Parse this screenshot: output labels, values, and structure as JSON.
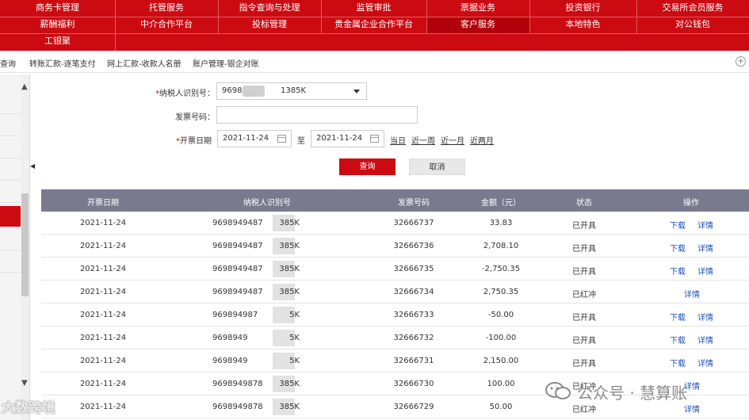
{
  "top_nav": {
    "row1": [
      "商务卡管理",
      "托管服务",
      "指令查询与处理",
      "监管审批",
      "票据业务",
      "投资银行",
      "交易所会员服务"
    ],
    "row2": [
      "薪酬福利",
      "中介合作平台",
      "投标管理",
      "贵金属企业合作平台",
      "客户服务",
      "本地特色",
      "对公钱包"
    ],
    "row3": [
      "工银聚"
    ],
    "active_item": "客户服务",
    "brand_color": "#cc0a12"
  },
  "sub_tabs": [
    "查询",
    "转账汇款-逐笔支付",
    "网上汇款-收款人名册",
    "账户管理-银企对账"
  ],
  "form": {
    "taxpayer_label": "纳税人识别号：",
    "taxpayer_value_start": "9698",
    "taxpayer_value_end": "1385K",
    "invoice_no_label": "发票号码：",
    "invoice_no_value": "",
    "date_label": "开票日期",
    "date_from": "2021-11-24",
    "date_sep": "至",
    "date_to": "2021-11-24",
    "quick_links": [
      "当日",
      "近一周",
      "近一月",
      "近两月"
    ],
    "query_button": "查询",
    "cancel_button": "取消"
  },
  "table": {
    "headers": [
      "开票日期",
      "纳税人识别号",
      "发票号码",
      "金额（元）",
      "状态",
      "操作"
    ],
    "rows": [
      {
        "date": "2021-11-24",
        "tax_id": "9698949487",
        "tax_id_end": "385K",
        "invoice_no": "32666737",
        "amount": "33.83",
        "status": "已开具",
        "ops": [
          "下载",
          "详情"
        ]
      },
      {
        "date": "2021-11-24",
        "tax_id": "9698949487",
        "tax_id_end": "385K",
        "invoice_no": "32666736",
        "amount": "2,708.10",
        "status": "已开具",
        "ops": [
          "下载",
          "详情"
        ]
      },
      {
        "date": "2021-11-24",
        "tax_id": "9698949487",
        "tax_id_end": "385K",
        "invoice_no": "32666735",
        "amount": "-2,750.35",
        "status": "已开具",
        "ops": [
          "下载",
          "详情"
        ]
      },
      {
        "date": "2021-11-24",
        "tax_id": "9698949487",
        "tax_id_end": "385K",
        "invoice_no": "32666734",
        "amount": "2,750.35",
        "status": "已红冲",
        "ops": [
          "详情"
        ]
      },
      {
        "date": "2021-11-24",
        "tax_id": "969894987",
        "tax_id_end": "5K",
        "invoice_no": "32666733",
        "amount": "-50.00",
        "status": "已开具",
        "ops": [
          "下载",
          "详情"
        ]
      },
      {
        "date": "2021-11-24",
        "tax_id": "9698949",
        "tax_id_end": "5K",
        "invoice_no": "32666732",
        "amount": "-100.00",
        "status": "已开具",
        "ops": [
          "下载",
          "详情"
        ]
      },
      {
        "date": "2021-11-24",
        "tax_id": "9698949",
        "tax_id_end": "5K",
        "invoice_no": "32666731",
        "amount": "2,150.00",
        "status": "已开具",
        "ops": [
          "下载",
          "详情"
        ]
      },
      {
        "date": "2021-11-24",
        "tax_id": "9698949878",
        "tax_id_end": "385K",
        "invoice_no": "32666730",
        "amount": "100.00",
        "status": "已红冲",
        "ops": [
          "详情"
        ]
      },
      {
        "date": "2021-11-24",
        "tax_id": "9698949878",
        "tax_id_end": "385K",
        "invoice_no": "32666729",
        "amount": "50.00",
        "status": "已红冲",
        "ops": [
          "详情"
        ]
      }
    ]
  },
  "watermarks": {
    "left": "大数跨境",
    "right": "公众号 · 慧算账"
  },
  "icons": {
    "add_tab": "plus-circle-icon",
    "dropdown": "chevron-down-icon",
    "calendar": "calendar-icon",
    "collapse": "caret-left-icon"
  }
}
